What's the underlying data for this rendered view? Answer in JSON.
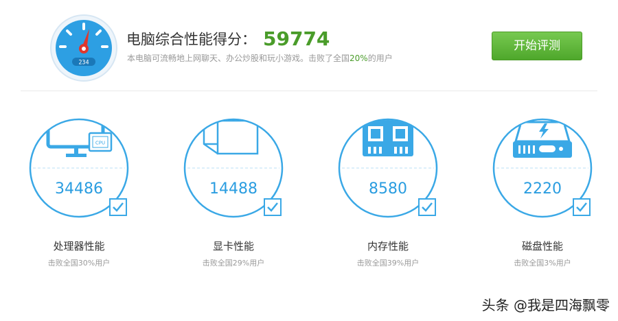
{
  "header": {
    "score_label": "电脑综合性能得分：",
    "score_value": "59774",
    "desc_before": "本电脑可流畅地上网聊天、办公炒股和玩小游戏。击败了全国",
    "desc_percent": "20%",
    "desc_after": "的用户",
    "gauge_readout": "234",
    "start_button": "开始评测"
  },
  "components": [
    {
      "name": "处理器性能",
      "score": "34486",
      "sub": "击败全国30%用户",
      "icon": "monitor-cpu-icon",
      "chip_text": "CPU"
    },
    {
      "name": "显卡性能",
      "score": "14488",
      "sub": "击败全国29%用户",
      "icon": "graphics-cube-icon"
    },
    {
      "name": "内存性能",
      "score": "8580",
      "sub": "击败全国39%用户",
      "icon": "memory-chip-icon"
    },
    {
      "name": "磁盘性能",
      "score": "2220",
      "sub": "击败全国3%用户",
      "icon": "hard-disk-icon"
    }
  ],
  "watermark": "头条 @我是四海飘零",
  "colors": {
    "accent_blue": "#2a9de0",
    "score_green": "#4a9c2a",
    "button_green": "#5cb534"
  }
}
